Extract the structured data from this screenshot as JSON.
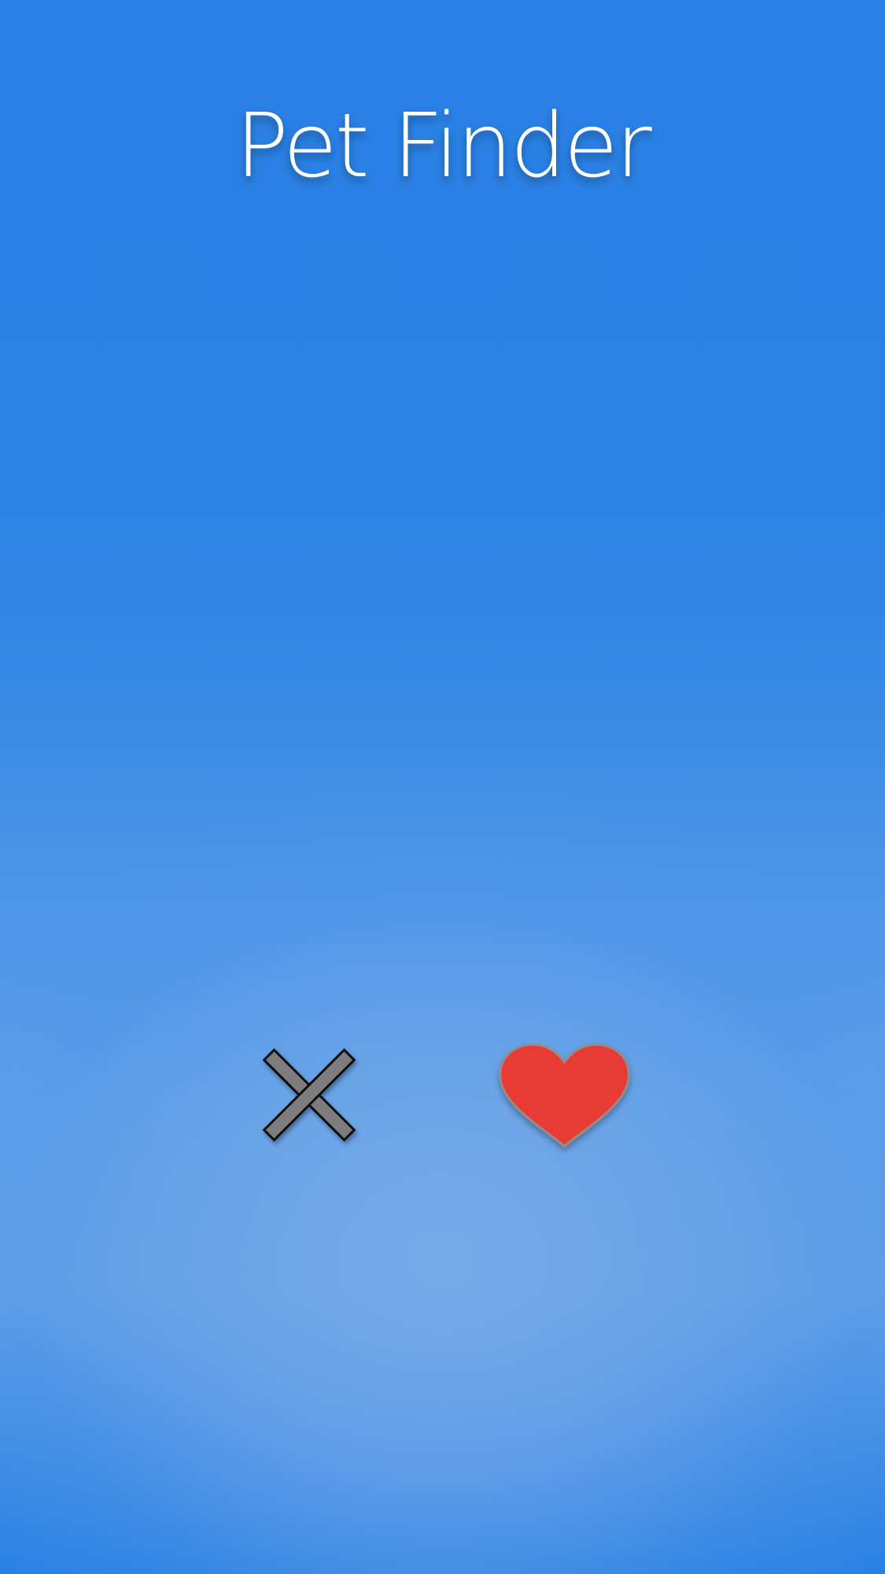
{
  "app": {
    "title": "Pet Finder"
  },
  "actions": {
    "reject_icon": "close-x-icon",
    "like_icon": "heart-icon"
  },
  "colors": {
    "background": "#2a80e3",
    "heart_fill": "#e83a36",
    "x_fill": "#7d7d7d"
  }
}
